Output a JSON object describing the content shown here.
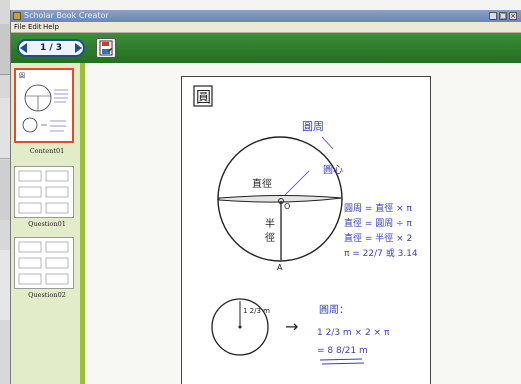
{
  "window": {
    "title": "Scholar Book Creator",
    "controls": [
      "minimize",
      "maximize",
      "close"
    ]
  },
  "menu": [
    "File",
    "Edit",
    "Help"
  ],
  "toolbar": {
    "page_counter": "1 / 3",
    "prev_icon": "triangle-left-icon",
    "next_icon": "triangle-right-icon",
    "save_icon": "save-icon"
  },
  "thumbnails": [
    {
      "label": "Content01",
      "selected": true
    },
    {
      "label": "Question01",
      "selected": false
    },
    {
      "label": "Question02",
      "selected": false
    }
  ],
  "page": {
    "heading_char": "圓",
    "annotations": {
      "circumference_label": "圓周",
      "center_label": "圓心",
      "diameter_label": "直徑",
      "radius_label_1": "半",
      "radius_label_2": "徑",
      "point_o": "O",
      "point_a": "A"
    },
    "formulas": [
      "圓周 = 直徑 × π",
      "直徑 = 圓周 ÷ π",
      "直徑 = 半徑 × 2",
      "π = 22/7 或 3.14"
    ],
    "example": {
      "radius_label": "1 2/3 m",
      "arrow": "→",
      "title": "圓周：",
      "line1": "1 2/3 m × 2 × π",
      "line2": "= 8 8/21 m"
    }
  },
  "colors": {
    "toolbar_green": "#2b7a2a",
    "sidebar_green": "#9bbf3a",
    "selected_border": "#e04b2a",
    "ink_black": "#222222",
    "ink_blue": "#3b3fb0"
  }
}
